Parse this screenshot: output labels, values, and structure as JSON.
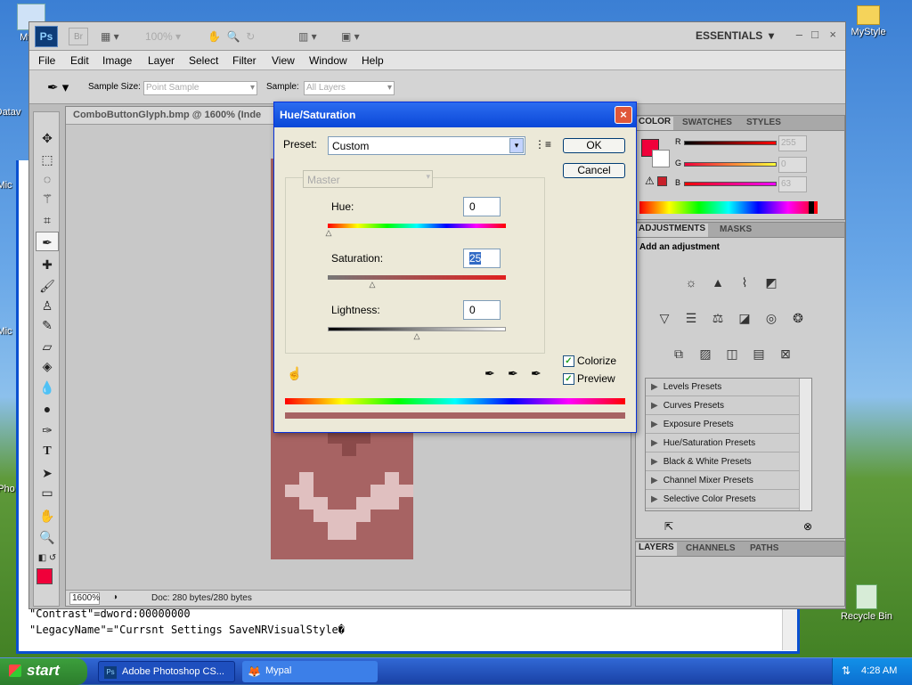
{
  "desktop": {
    "icons": [
      {
        "label": "My C",
        "icon": "my-computer-icon"
      },
      {
        "label": "MyStyle",
        "icon": "folder-icon"
      },
      {
        "label": "Recycle Bin",
        "icon": "recycle-bin-icon"
      }
    ],
    "edge_labels": [
      "Datav",
      "Mic",
      "Mic",
      "Pho"
    ]
  },
  "notepad": {
    "lines": [
      "\"Contrast\"=dword:00000000",
      "\"LegacyName\"=\"Currsnt Settings SaveNRVisualStyle�"
    ]
  },
  "photoshop": {
    "logo": "Ps",
    "bridge_label": "Br",
    "zoom_combo": "100%",
    "workspace": "ESSENTIALS",
    "menu": [
      "File",
      "Edit",
      "Image",
      "Layer",
      "Select",
      "Filter",
      "View",
      "Window",
      "Help"
    ],
    "options": {
      "sample_size_label": "Sample Size:",
      "sample_size_value": "Point Sample",
      "sample_label": "Sample:",
      "sample_value": "All Layers"
    },
    "document": {
      "tab_title": "ComboButtonGlyph.bmp @ 1600% (Inde",
      "zoom": "1600%",
      "doc_info": "Doc: 280 bytes/280 bytes"
    },
    "color_panel": {
      "tabs": [
        "COLOR",
        "SWATCHES",
        "STYLES"
      ],
      "channels": [
        {
          "label": "R",
          "value": "255"
        },
        {
          "label": "G",
          "value": "0"
        },
        {
          "label": "B",
          "value": "63"
        }
      ],
      "foreground": "#f0003a"
    },
    "adjustments_panel": {
      "tabs": [
        "ADJUSTMENTS",
        "MASKS"
      ],
      "heading": "Add an adjustment",
      "presets": [
        "Levels Presets",
        "Curves Presets",
        "Exposure Presets",
        "Hue/Saturation Presets",
        "Black & White Presets",
        "Channel Mixer Presets",
        "Selective Color Presets"
      ]
    },
    "layers_panel": {
      "tabs": [
        "LAYERS",
        "CHANNELS",
        "PATHS"
      ]
    }
  },
  "dialog": {
    "title": "Hue/Saturation",
    "preset_label": "Preset:",
    "preset_value": "Custom",
    "channel_value": "Master",
    "hue_label": "Hue:",
    "hue_value": "0",
    "saturation_label": "Saturation:",
    "saturation_value": "25",
    "lightness_label": "Lightness:",
    "lightness_value": "0",
    "ok_label": "OK",
    "cancel_label": "Cancel",
    "colorize_label": "Colorize",
    "preview_label": "Preview",
    "colorize_checked": true,
    "preview_checked": true,
    "result_color": "#a76363"
  },
  "taskbar": {
    "start_label": "start",
    "items": [
      "Adobe Photoshop CS...",
      "Mypal"
    ],
    "clock": "4:28 AM"
  }
}
